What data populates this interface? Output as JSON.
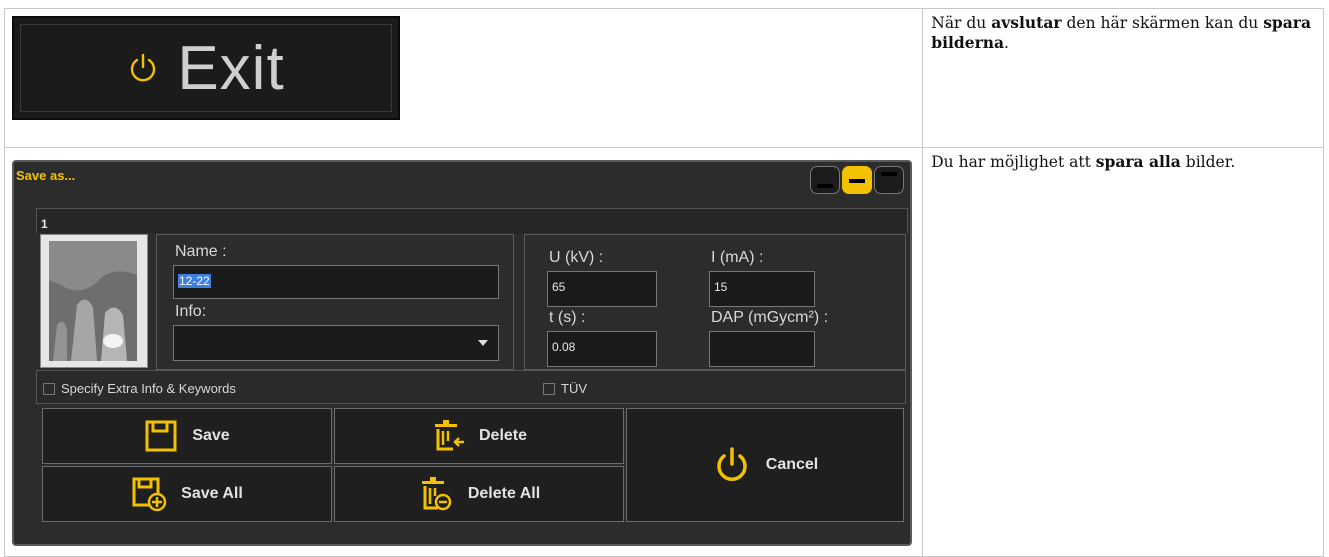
{
  "exit_button": {
    "label": "Exit",
    "icon": "power-icon"
  },
  "desc_1": {
    "t1": "När du ",
    "b1": "avslutar",
    "t2": " den här skärmen kan du ",
    "b2": "spara bilderna",
    "t3": "."
  },
  "desc_2": {
    "t1": "Du har möjlighet att ",
    "b1": "spara alla",
    "t2": " bilder."
  },
  "dialog": {
    "title": "Save as...",
    "item_number": "1",
    "name_label": "Name :",
    "name_value": "12-22",
    "info_label": "Info:",
    "info_value": "",
    "u_label": "U (kV) :",
    "u_value": "65",
    "i_label": "I (mA) :",
    "i_value": "15",
    "t_label": "t (s) :",
    "t_value": "0.08",
    "dap_label": "DAP (mGycm²) :",
    "dap_value": "",
    "extra_info_label": "Specify Extra Info & Keywords",
    "tuv_label": "TÜV",
    "buttons": {
      "save": "Save",
      "delete": "Delete",
      "save_all": "Save All",
      "delete_all": "Delete All",
      "cancel": "Cancel"
    },
    "accent_color": "#f2c200"
  }
}
